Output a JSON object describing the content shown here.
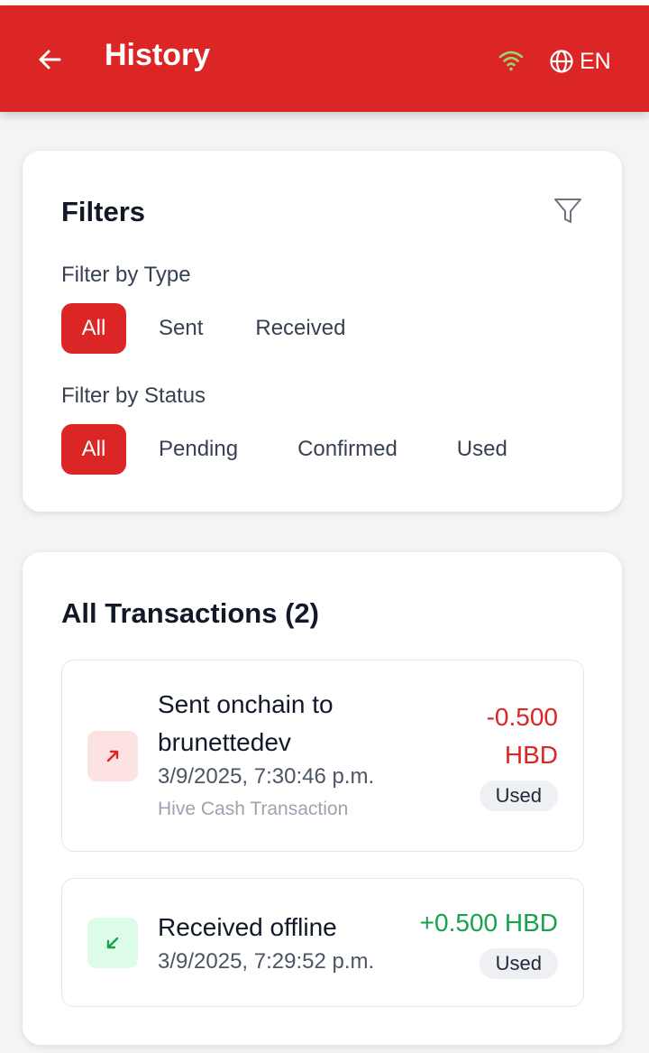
{
  "header": {
    "title": "History",
    "back_icon": "arrow-left-icon",
    "connection_icon": "wifi-icon",
    "language_icon": "globe-icon",
    "language": "EN",
    "header_color": "#dc2626",
    "connection_color": "#9bd66a"
  },
  "filters": {
    "title": "Filters",
    "icon": "funnel-icon",
    "type_label": "Filter by Type",
    "type_options": [
      "All",
      "Sent",
      "Received"
    ],
    "type_selected": "All",
    "status_label": "Filter by Status",
    "status_options": [
      "All",
      "Pending",
      "Confirmed",
      "Used"
    ],
    "status_selected": "All"
  },
  "transactions": {
    "title": "All Transactions (2)",
    "items": [
      {
        "direction_icon": "arrow-up-right-icon",
        "description_line1": "Sent onchain to",
        "description_line2": "brunettedev",
        "date": "3/9/2025, 7:30:46 p.m.",
        "subtitle": "Hive Cash Transaction",
        "amount_line1": "-0.500",
        "amount_line2": "HBD",
        "status": "Used",
        "amount_color": "#dc2626"
      },
      {
        "direction_icon": "arrow-down-left-icon",
        "description": "Received offline",
        "date": "3/9/2025, 7:29:52 p.m.",
        "amount": "+0.500 HBD",
        "status": "Used",
        "amount_color": "#16a34a"
      }
    ]
  }
}
